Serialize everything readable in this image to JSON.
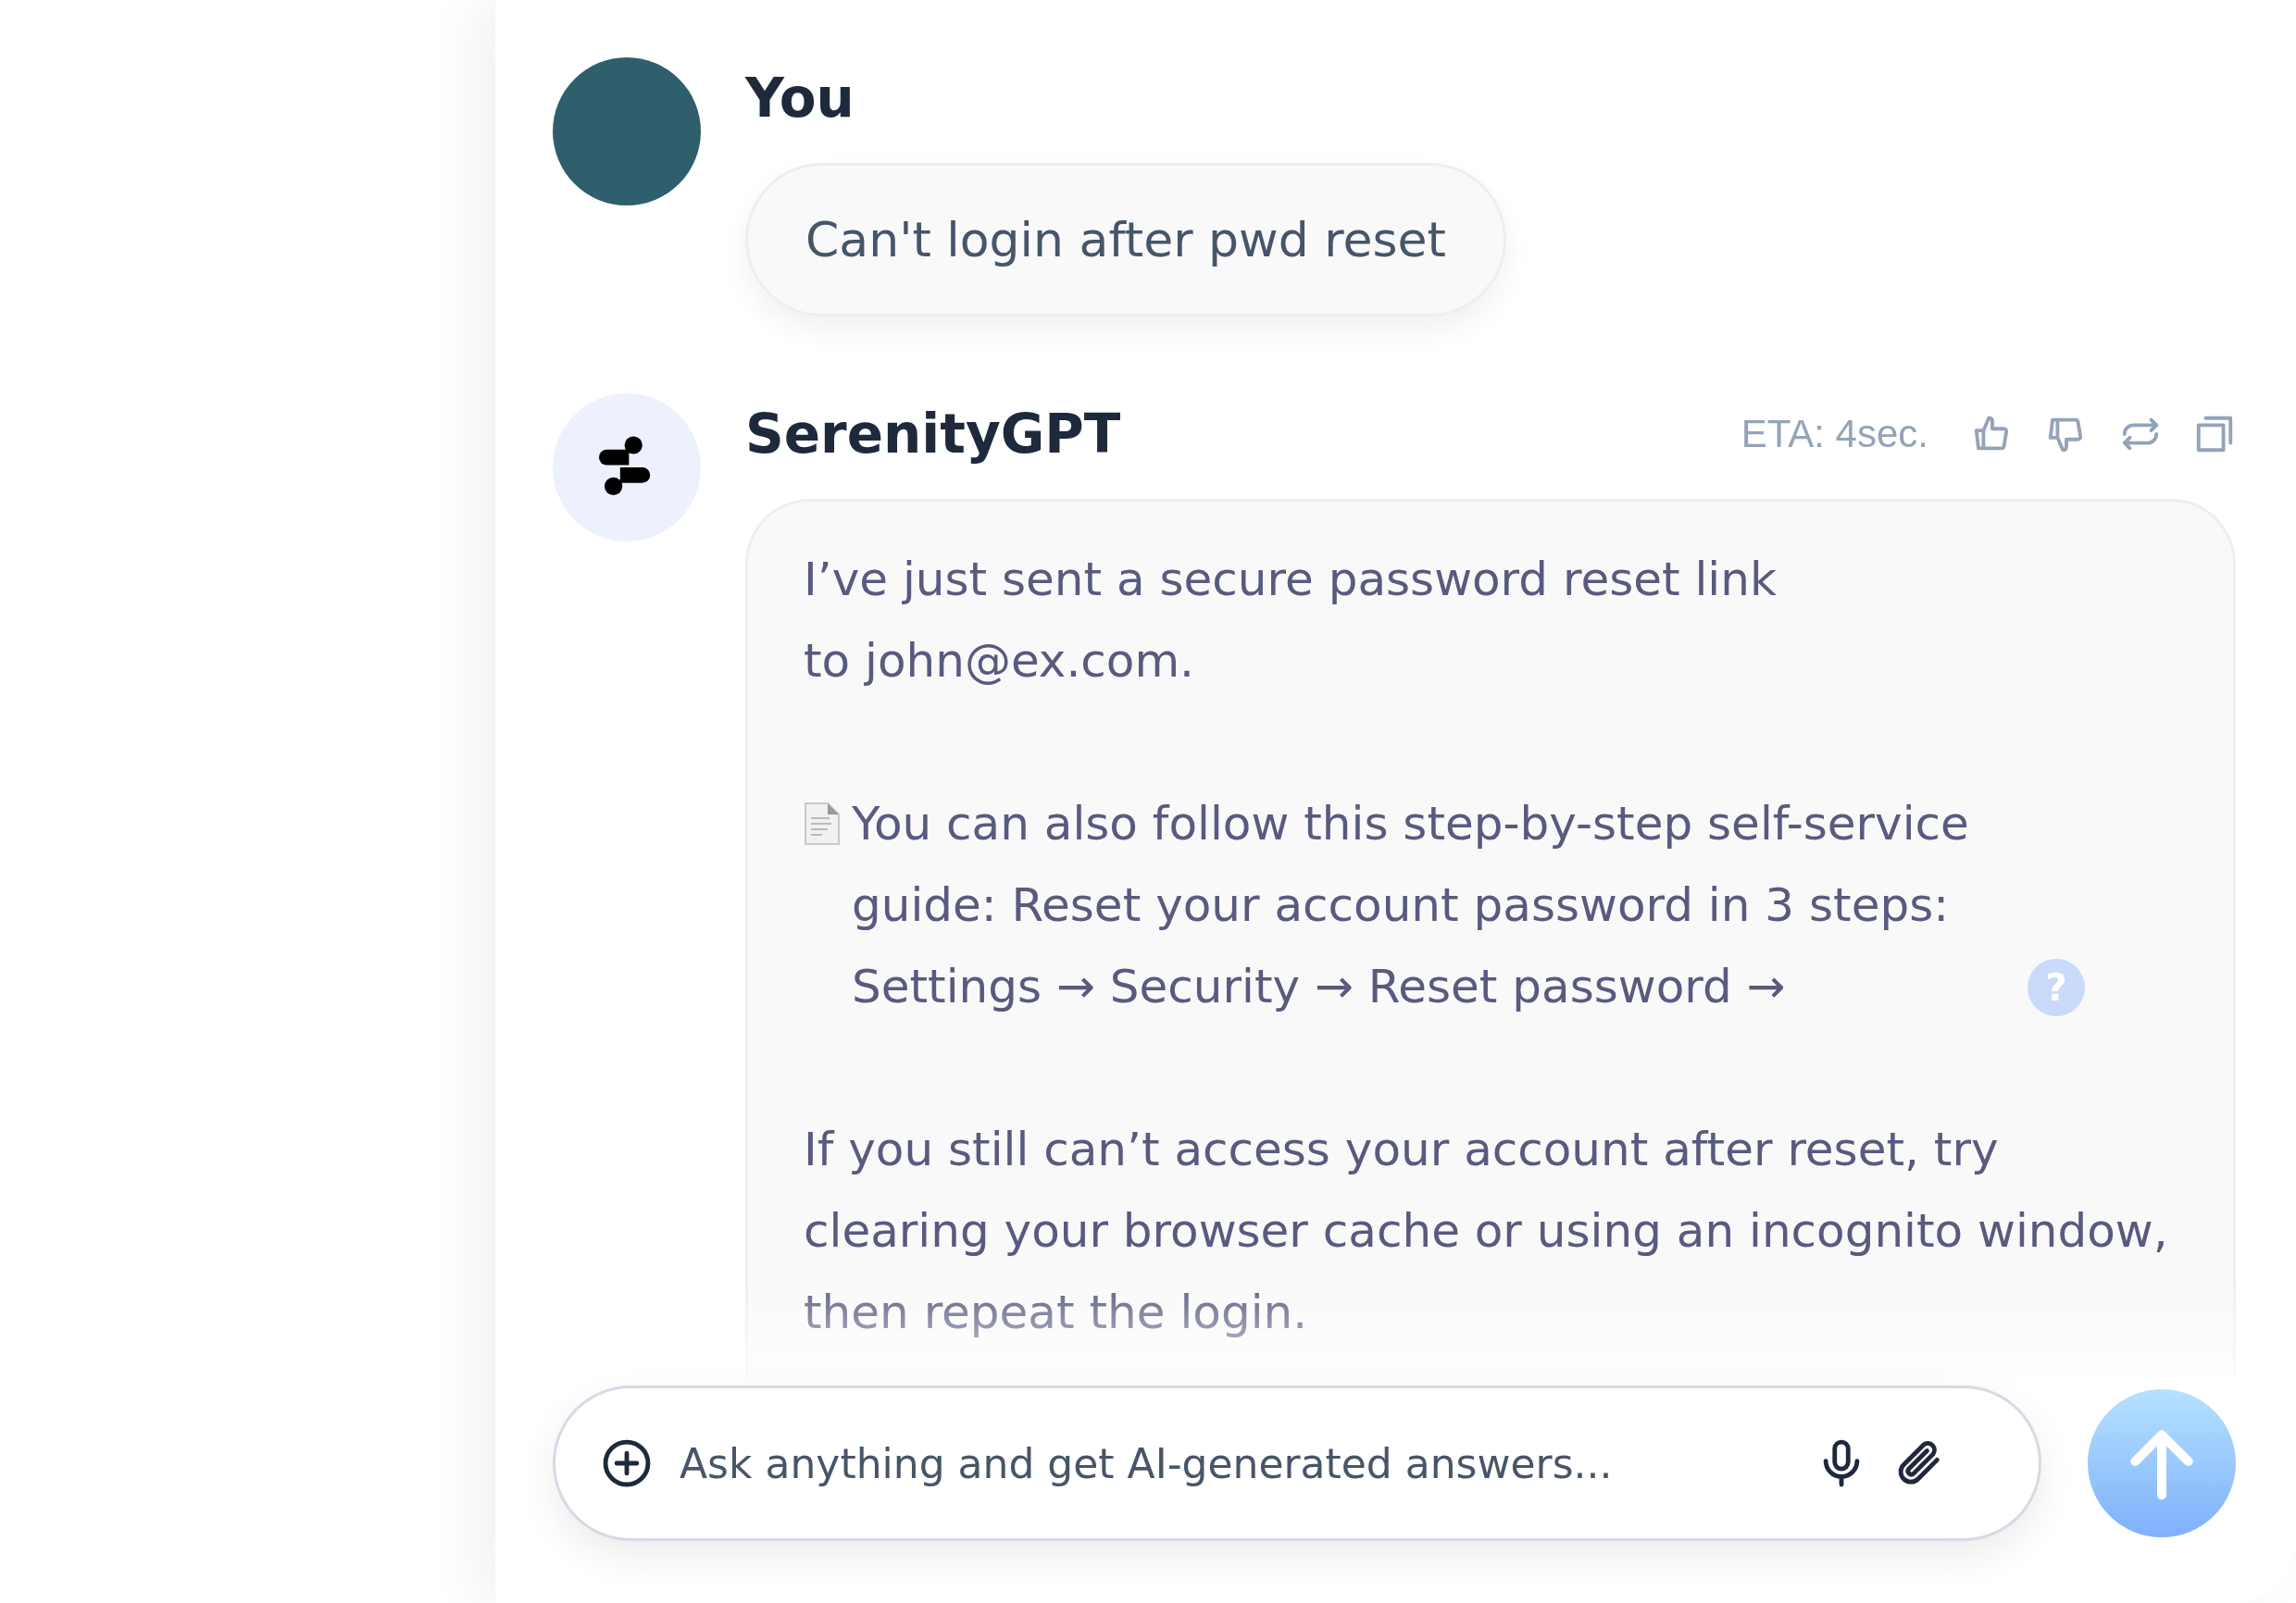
{
  "user_message": {
    "author": "You",
    "text": "Can't login after pwd reset"
  },
  "bot_message": {
    "author": "SerenityGPT",
    "eta": "ETA: 4sec.",
    "paragraphs": [
      {
        "kind": "lines",
        "lines": [
          "I’ve just sent a secure password reset link",
          "to john@ex.com."
        ]
      },
      {
        "kind": "guide",
        "text": "You can also follow this step-by-step self-service guide: Reset your account password in 3 steps: Settings → Security → Reset password →",
        "help_badge": "?"
      },
      {
        "kind": "text",
        "text": "If you still can’t access your account after reset, try clearing your browser cache or using an incognito window, then repeat the login."
      }
    ]
  },
  "composer": {
    "placeholder": "Ask anything and get AI-generated answers..."
  }
}
